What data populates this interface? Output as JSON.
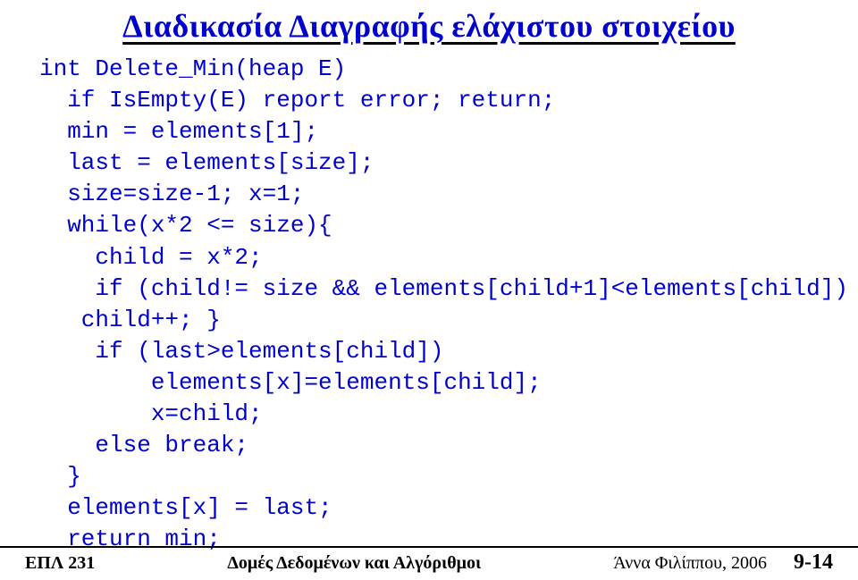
{
  "title": "Διαδικασία Διαγραφής ελάχιστου στοιχείου",
  "code": {
    "l1": "int Delete_Min(heap E)",
    "l2": "  if IsEmpty(E) report error; return;",
    "l3": "  min = elements[1];",
    "l4": "  last = elements[size];",
    "l5": "  size=size-1; x=1;",
    "l6": "  while(x*2 <= size){",
    "l7": "    child = x*2;",
    "l8": "    if (child!= size && elements[child+1]<elements[child])",
    "l9": "   child++; }",
    "l10": "    if (last>elements[child])",
    "l11": "        elements[x]=elements[child];",
    "l12": "        x=child;",
    "l13": "    else break;",
    "l14": "  }",
    "l15": "  elements[x] = last;",
    "l16": "  return min;"
  },
  "footer": {
    "left": "ΕΠΛ 231",
    "center": "Δομές Δεδομένων και Αλγόριθμοι",
    "right_author": "Άννα Φιλίππου, 2006",
    "page": "9-14"
  }
}
